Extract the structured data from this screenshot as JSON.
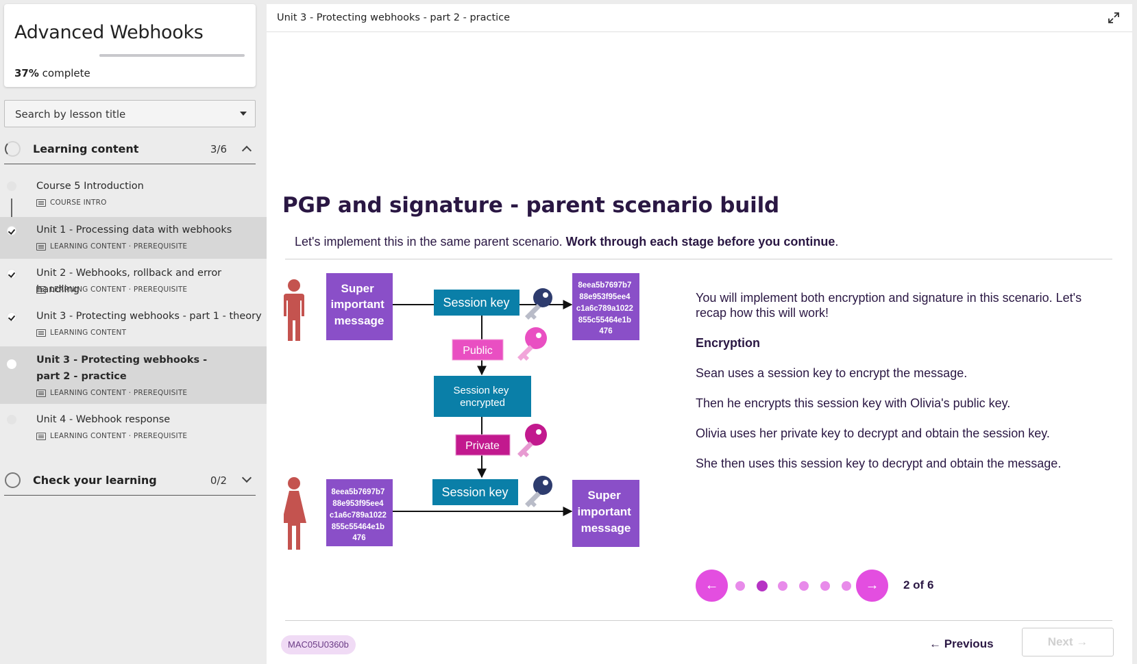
{
  "sidebar": {
    "course_title": "Advanced Webhooks",
    "progress_percent": "37%",
    "progress_suffix": " complete",
    "progress_fraction": 0.37,
    "search_placeholder": "Search by lesson title",
    "sections": [
      {
        "title": "Learning content",
        "count": "3/6",
        "expanded": true,
        "lessons": [
          {
            "name": "Course 5 Introduction",
            "meta": "COURSE INTRO",
            "status": "not-started"
          },
          {
            "name": "Unit 1 - Processing data with webhooks",
            "meta": "LEARNING CONTENT · PREREQUISITE",
            "status": "done"
          },
          {
            "name": "Unit 2 - Webhooks, rollback and error handling",
            "meta": "LEARNING CONTENT · PREREQUISITE",
            "status": "done"
          },
          {
            "name": "Unit 3 - Protecting webhooks - part 1 - theory",
            "meta": "LEARNING CONTENT",
            "status": "done"
          },
          {
            "name": "Unit 3 - Protecting webhooks - part 2 - practice",
            "meta": "LEARNING CONTENT · PREREQUISITE",
            "status": "current"
          },
          {
            "name": "Unit 4 - Webhook response",
            "meta": "LEARNING CONTENT · PREREQUISITE",
            "status": "not-started"
          }
        ]
      },
      {
        "title": "Check your learning",
        "count": "0/2",
        "expanded": false
      }
    ]
  },
  "main": {
    "breadcrumb": "Unit 3 - Protecting webhooks - part 2 - practice",
    "slide_title": "PGP and signature - parent scenario build",
    "intro_plain": "Let's implement this in the same parent scenario. ",
    "intro_bold": "Work through each stage before you continue",
    "intro_end": ".",
    "diagram": {
      "message": [
        "Super",
        "important",
        "message"
      ],
      "session_key": "Session key",
      "public": "Public",
      "session_key_encrypted": [
        "Session key",
        "encrypted"
      ],
      "private": "Private",
      "hash": [
        "8eea5b7697b7",
        "88e953f95ee4",
        "c1a6c789a1022",
        "855c55464e1b",
        "476"
      ]
    },
    "explanation": {
      "intro": "You will implement both encryption and signature in this scenario. Let's recap how this will work!",
      "heading": "Encryption",
      "steps": [
        "Sean uses a session key to encrypt the message.",
        "Then he encrypts this session key with Olivia's public key.",
        "Olivia uses her private key to decrypt and obtain the session key.",
        "She then uses this session key to decrypt and obtain the message."
      ]
    },
    "carousel": {
      "current": 2,
      "total": 6,
      "label": "2 of 6"
    },
    "tag": "MAC05U0360b",
    "previous_label": "← Previous",
    "next_label": "Next →"
  },
  "colors": {
    "accent": "#e34ee0",
    "purple_box": "#8a4fc8",
    "teal_box": "#0a7fa8",
    "public_box": "#e94fc2",
    "private_box": "#c2198e",
    "person": "#c4534f",
    "dark_text": "#2a1743"
  }
}
